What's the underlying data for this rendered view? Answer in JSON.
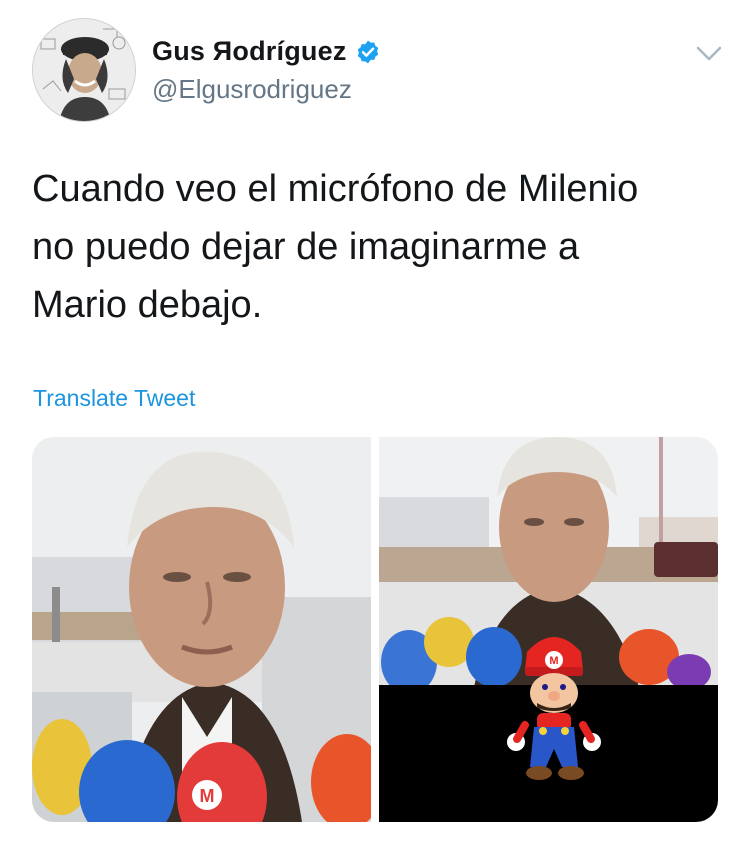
{
  "tweet": {
    "author": {
      "display_name": "Gus Яodríguez",
      "handle": "@Elgusrodriguez",
      "verified_icon": "verified-badge-icon",
      "avatar": "user-avatar"
    },
    "menu_icon": "chevron-down-icon",
    "text": "Cuando veo el micrófono de Milenio\nno puedo dejar de imaginarme a\nMario debajo.",
    "translate_label": "Translate Tweet",
    "media": {
      "left_image": {
        "description_icon": "press-photo",
        "mic_logo": "M"
      },
      "right_image": {
        "description_icon": "press-photo-with-mario",
        "cap_logo": "M"
      }
    }
  },
  "colors": {
    "link": "#1b95e0",
    "verified": "#1da1f2",
    "secondary_text": "#657786",
    "primary_text": "#14171a"
  }
}
